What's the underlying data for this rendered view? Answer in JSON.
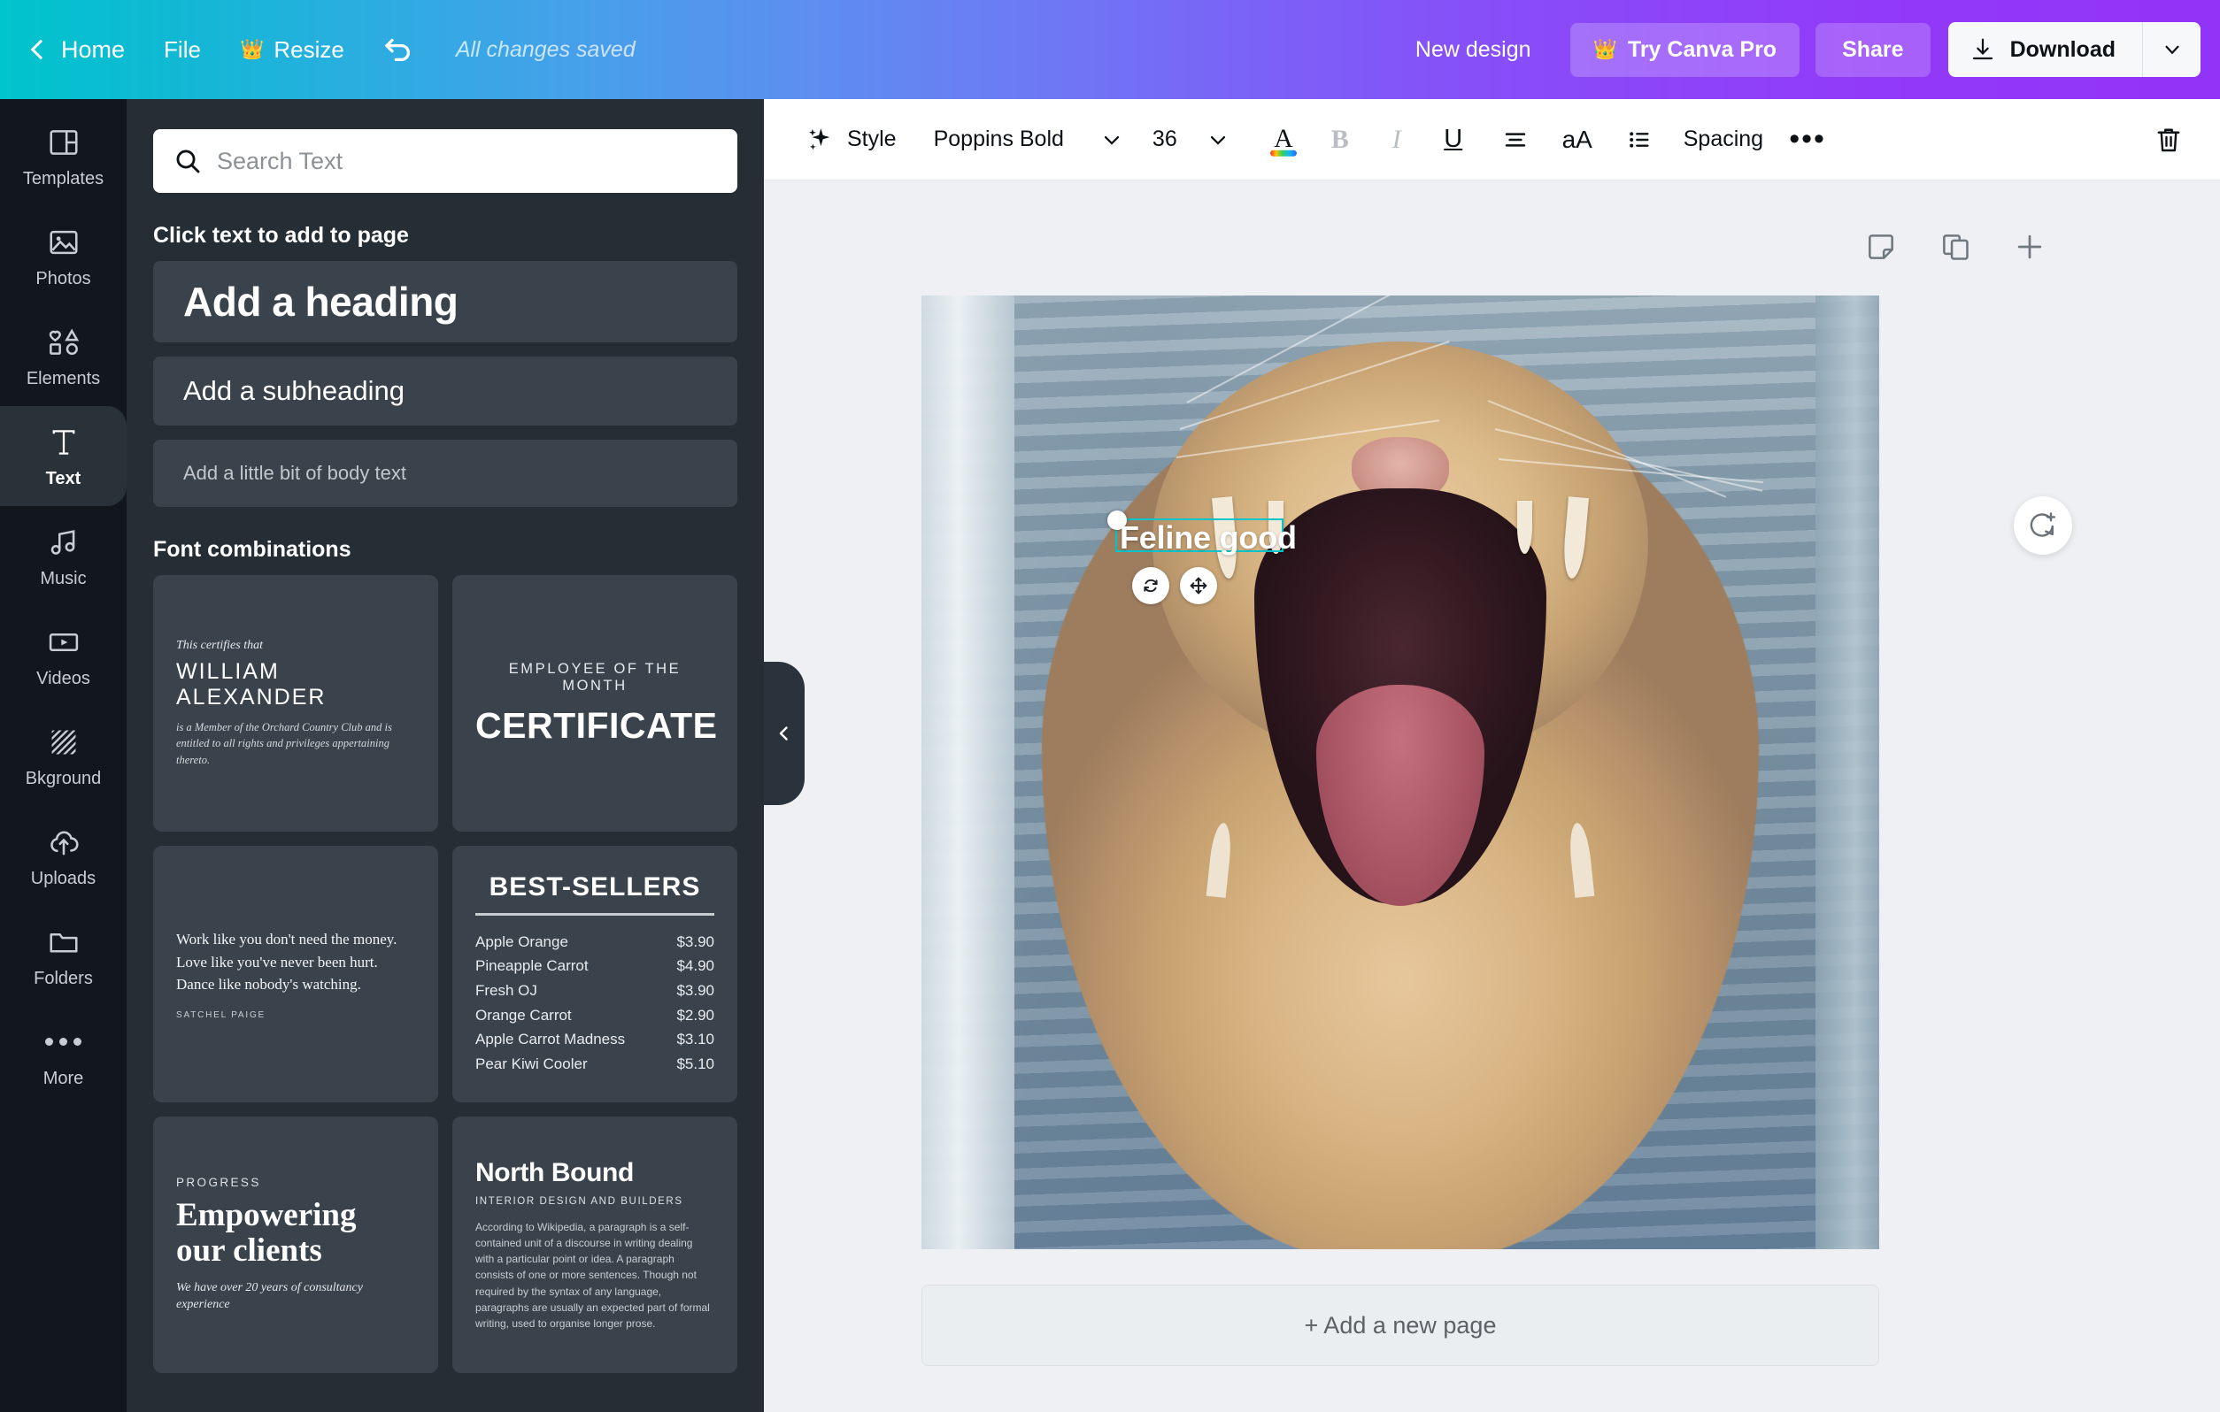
{
  "topbar": {
    "home": "Home",
    "file": "File",
    "resize": "Resize",
    "undo_icon": "undo-icon",
    "saved_status": "All changes saved",
    "new_design": "New design",
    "try_pro": "Try Canva Pro",
    "share": "Share",
    "download": "Download",
    "crown_icon": "crown-icon",
    "colors": {
      "gradient_start": "#00C4CC",
      "gradient_end": "#9233F8"
    }
  },
  "rail": {
    "items": [
      {
        "label": "Templates",
        "icon": "templates-icon",
        "active": false
      },
      {
        "label": "Photos",
        "icon": "photos-icon",
        "active": false
      },
      {
        "label": "Elements",
        "icon": "elements-icon",
        "active": false
      },
      {
        "label": "Text",
        "icon": "text-icon",
        "active": true
      },
      {
        "label": "Music",
        "icon": "music-icon",
        "active": false
      },
      {
        "label": "Videos",
        "icon": "videos-icon",
        "active": false
      },
      {
        "label": "Bkground",
        "icon": "background-icon",
        "active": false
      },
      {
        "label": "Uploads",
        "icon": "uploads-icon",
        "active": false
      },
      {
        "label": "Folders",
        "icon": "folders-icon",
        "active": false
      },
      {
        "label": "More",
        "icon": "more-dots-icon",
        "active": false
      }
    ]
  },
  "panel": {
    "search_placeholder": "Search Text",
    "search_icon": "search-icon",
    "click_text_title": "Click text to add to page",
    "add_heading": "Add a heading",
    "add_subheading": "Add a subheading",
    "add_body": "Add a little bit of body text",
    "font_combinations_title": "Font combinations",
    "combos": {
      "certificate": {
        "script": "This certifies that",
        "name": "WILLIAM ALEXANDER",
        "body": "is a Member of the Orchard Country Club and is entitled to all rights and privileges appertaining thereto."
      },
      "employee": {
        "eyebrow": "EMPLOYEE OF THE MONTH",
        "title": "CERTIFICATE"
      },
      "quote": {
        "line1": "Work like you don't need the money.",
        "line2": "Love like you've never been hurt.",
        "line3": "Dance like nobody's watching.",
        "attribution": "SATCHEL PAIGE"
      },
      "bestsellers": {
        "title": "BEST-SELLERS",
        "rows": [
          {
            "name": "Apple Orange",
            "price": "$3.90"
          },
          {
            "name": "Pineapple Carrot",
            "price": "$4.90"
          },
          {
            "name": "Fresh OJ",
            "price": "$3.90"
          },
          {
            "name": "Orange Carrot",
            "price": "$2.90"
          },
          {
            "name": "Apple Carrot Madness",
            "price": "$3.10"
          },
          {
            "name": "Pear Kiwi Cooler",
            "price": "$5.10"
          }
        ]
      },
      "progress": {
        "eyebrow": "PROGRESS",
        "title_l1": "Empowering",
        "title_l2": "our clients",
        "body": "We have over 20 years of consultancy experience"
      },
      "northbound": {
        "title": "North Bound",
        "subtitle": "INTERIOR DESIGN AND BUILDERS",
        "body": "According to Wikipedia, a paragraph is a self-contained unit of a discourse in writing dealing with a particular point or idea. A paragraph consists of one or more sentences. Though not required by the syntax of any language, paragraphs are usually an expected part of formal writing, used to organise longer prose."
      }
    },
    "collapse_icon": "chevron-left-icon"
  },
  "toolbar": {
    "style_label": "Style",
    "style_icon": "sparkle-icon",
    "font_family": "Poppins Bold",
    "font_size": "36",
    "text_color_icon": "text-color-icon",
    "bold_icon": "bold-icon",
    "italic_icon": "italic-icon",
    "underline_icon": "underline-icon",
    "align_icon": "align-center-icon",
    "case_icon": "text-case-icon",
    "list_icon": "bullet-list-icon",
    "spacing_label": "Spacing",
    "more_icon": "more-dots-icon",
    "delete_icon": "trash-icon"
  },
  "page_tools": {
    "notes_icon": "notes-icon",
    "duplicate_icon": "duplicate-page-icon",
    "add_icon": "plus-icon"
  },
  "canvas": {
    "selected_text": "Feline good",
    "selection_color": "#00C4CC",
    "rotate_icon": "rotate-icon",
    "move_icon": "move-icon",
    "comment_icon": "add-comment-icon",
    "add_new_page": "+ Add a new page"
  }
}
